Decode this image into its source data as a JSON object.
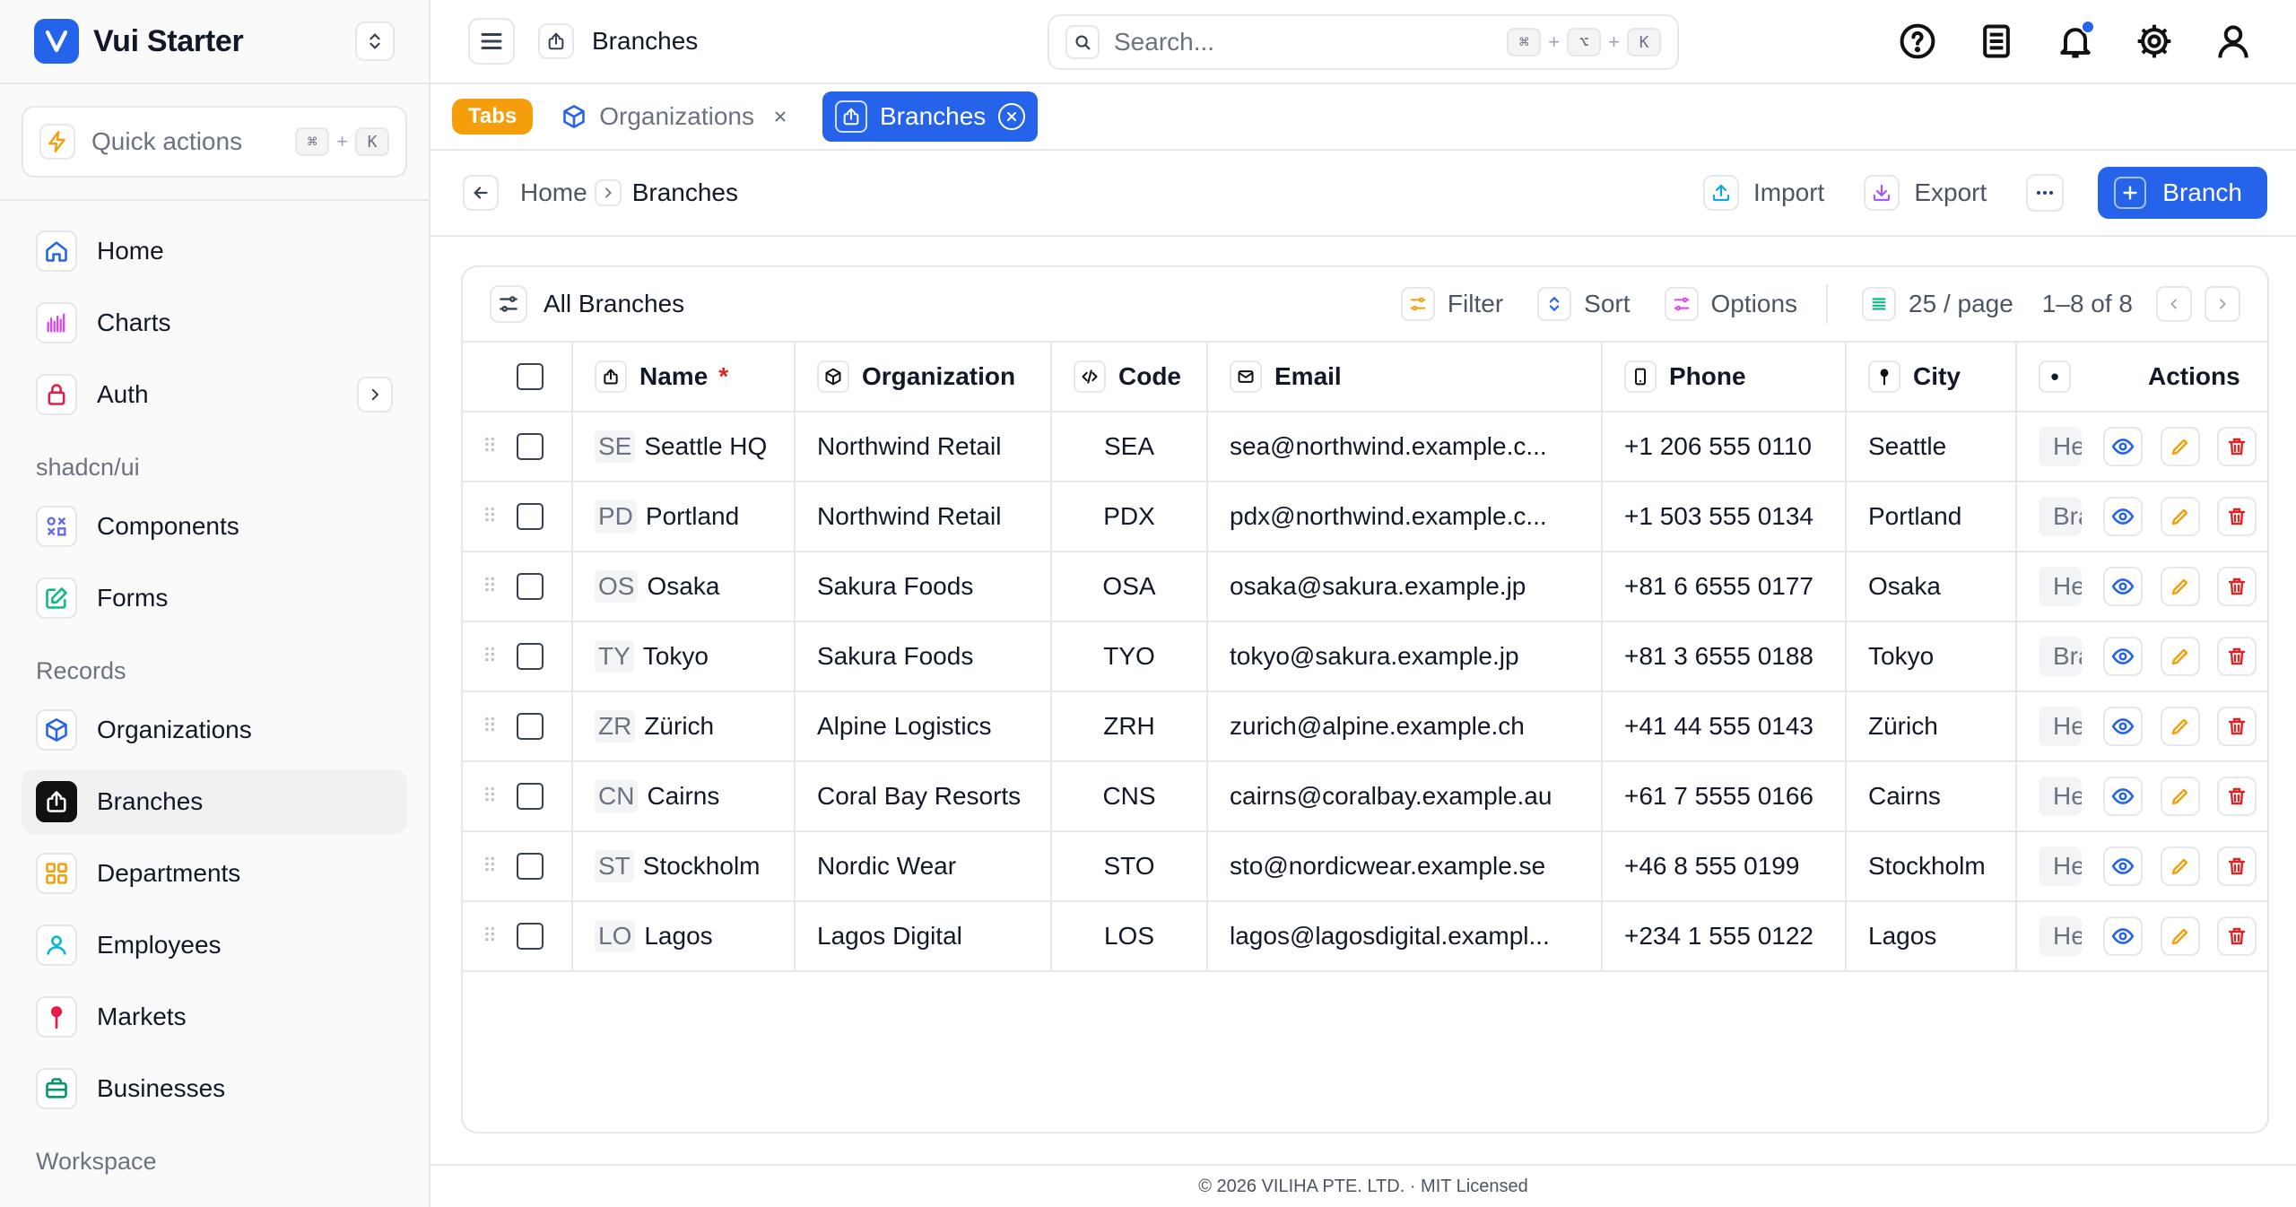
{
  "brand": {
    "name": "Vui Starter"
  },
  "quick_actions": {
    "label": "Quick actions",
    "keys": [
      "⌘",
      "K"
    ]
  },
  "sidebar": {
    "main_items": [
      {
        "label": "Home",
        "icon": "home-icon"
      },
      {
        "label": "Charts",
        "icon": "bar-chart-icon"
      },
      {
        "label": "Auth",
        "icon": "lock-icon"
      }
    ],
    "group_shadcn": "shadcn/ui",
    "shadcn_items": [
      {
        "label": "Components",
        "icon": "components-icon"
      },
      {
        "label": "Forms",
        "icon": "edit-form-icon"
      }
    ],
    "group_records": "Records",
    "record_items": [
      {
        "label": "Organizations",
        "icon": "box-icon"
      },
      {
        "label": "Branches",
        "icon": "branch-share-icon",
        "active": true
      },
      {
        "label": "Departments",
        "icon": "grid-icon"
      },
      {
        "label": "Employees",
        "icon": "user-icon"
      },
      {
        "label": "Markets",
        "icon": "pin-icon"
      },
      {
        "label": "Businesses",
        "icon": "briefcase-icon"
      }
    ],
    "group_workspace": "Workspace"
  },
  "topbar": {
    "title": "Branches",
    "search_placeholder": "Search...",
    "search_keys": [
      "⌘",
      "⌥",
      "K"
    ]
  },
  "tabs": {
    "badge": "Tabs",
    "items": [
      {
        "label": "Organizations",
        "active": false
      },
      {
        "label": "Branches",
        "active": true
      }
    ]
  },
  "breadcrumb": {
    "home": "Home",
    "current": "Branches"
  },
  "page_actions": {
    "import": "Import",
    "export": "Export",
    "primary": "Branch"
  },
  "table_toolbar": {
    "title": "All Branches",
    "filter": "Filter",
    "sort": "Sort",
    "options": "Options",
    "page_size": "25 / page",
    "range": "1–8 of 8"
  },
  "columns": {
    "name": "Name",
    "required_mark": "*",
    "organization": "Organization",
    "code": "Code",
    "email": "Email",
    "phone": "Phone",
    "city": "City",
    "status_dot": "•",
    "actions": "Actions"
  },
  "rows": [
    {
      "abbr": "SE",
      "name": "Seattle HQ",
      "org": "Northwind Retail",
      "code": "SEA",
      "email": "sea@northwind.example.c...",
      "phone": "+1 206 555 0110",
      "city": "Seattle",
      "desc": "He"
    },
    {
      "abbr": "PD",
      "name": "Portland",
      "org": "Northwind Retail",
      "code": "PDX",
      "email": "pdx@northwind.example.c...",
      "phone": "+1 503 555 0134",
      "city": "Portland",
      "desc": "Bra"
    },
    {
      "abbr": "OS",
      "name": "Osaka",
      "org": "Sakura Foods",
      "code": "OSA",
      "email": "osaka@sakura.example.jp",
      "phone": "+81 6 6555 0177",
      "city": "Osaka",
      "desc": "He"
    },
    {
      "abbr": "TY",
      "name": "Tokyo",
      "org": "Sakura Foods",
      "code": "TYO",
      "email": "tokyo@sakura.example.jp",
      "phone": "+81 3 6555 0188",
      "city": "Tokyo",
      "desc": "Bra"
    },
    {
      "abbr": "ZR",
      "name": "Zürich",
      "org": "Alpine Logistics",
      "code": "ZRH",
      "email": "zurich@alpine.example.ch",
      "phone": "+41 44 555 0143",
      "city": "Zürich",
      "desc": "He"
    },
    {
      "abbr": "CN",
      "name": "Cairns",
      "org": "Coral Bay Resorts",
      "code": "CNS",
      "email": "cairns@coralbay.example.au",
      "phone": "+61 7 5555 0166",
      "city": "Cairns",
      "desc": "He"
    },
    {
      "abbr": "ST",
      "name": "Stockholm",
      "org": "Nordic Wear",
      "code": "STO",
      "email": "sto@nordicwear.example.se",
      "phone": "+46 8 555 0199",
      "city": "Stockholm",
      "desc": "He"
    },
    {
      "abbr": "LO",
      "name": "Lagos",
      "org": "Lagos Digital",
      "code": "LOS",
      "email": "lagos@lagosdigital.exampl...",
      "phone": "+234 1 555 0122",
      "city": "Lagos",
      "desc": "He"
    }
  ],
  "footer": {
    "text": "© 2026 VILIHA PTE. LTD. · MIT Licensed"
  },
  "colors": {
    "primary": "#2563eb",
    "tabs_badge": "#f59e0b",
    "danger": "#dc2626",
    "edit": "#f59e0b"
  }
}
